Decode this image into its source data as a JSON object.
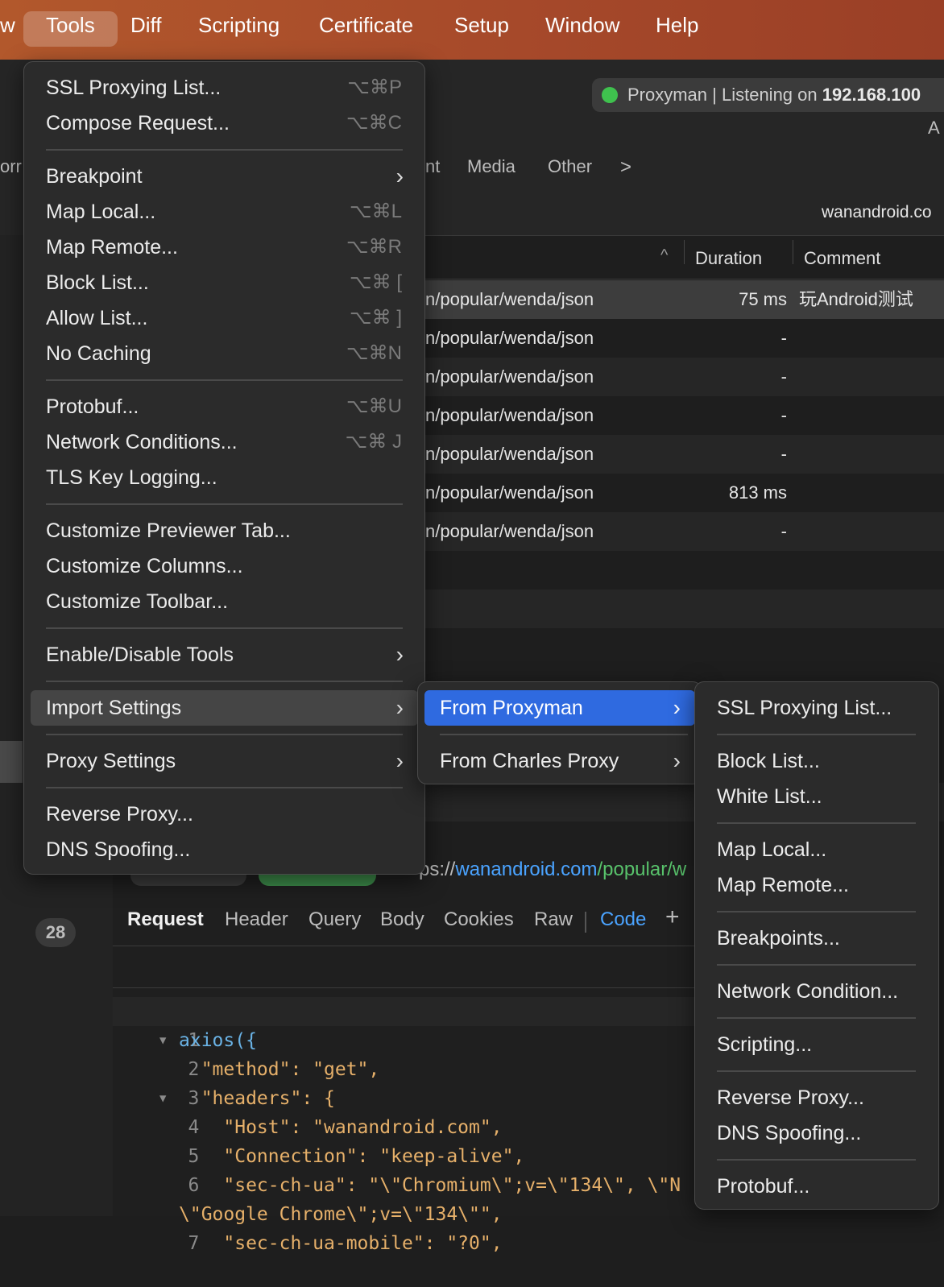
{
  "menubar": {
    "items": [
      "w",
      "Tools",
      "Diff",
      "Scripting",
      "Certificate",
      "Setup",
      "Window",
      "Help"
    ]
  },
  "status": {
    "text_prefix": "Proxyman | Listening on ",
    "ip": "192.168.100",
    "corner_label": "A"
  },
  "filters": {
    "partial": "orr",
    "partial2": "nt",
    "media": "Media",
    "other": "Other",
    "chevron": ">"
  },
  "domain_label": "wanandroid.co",
  "columns": {
    "duration": "Duration",
    "comment": "Comment",
    "sort": "^"
  },
  "rows": [
    {
      "path": "n/popular/wenda/json",
      "duration": "75 ms",
      "comment": "玩Android测试"
    },
    {
      "path": "n/popular/wenda/json",
      "duration": "-",
      "comment": ""
    },
    {
      "path": "n/popular/wenda/json",
      "duration": "-",
      "comment": ""
    },
    {
      "path": "n/popular/wenda/json",
      "duration": "-",
      "comment": ""
    },
    {
      "path": "n/popular/wenda/json",
      "duration": "-",
      "comment": ""
    },
    {
      "path": "n/popular/wenda/json",
      "duration": "813 ms",
      "comment": ""
    },
    {
      "path": "n/popular/wenda/json",
      "duration": "-",
      "comment": ""
    }
  ],
  "badge": "28",
  "url": {
    "prefix": "ps://",
    "host": "wanandroid.com",
    "path": "/popular/w"
  },
  "request_tabs": [
    "Request",
    "Header",
    "Query",
    "Body",
    "Cookies",
    "Raw",
    "Code",
    "+"
  ],
  "code_lines": [
    {
      "n": "1",
      "text": "axios({"
    },
    {
      "n": "2",
      "text": "  \"method\": \"get\","
    },
    {
      "n": "3",
      "text": "  \"headers\": {"
    },
    {
      "n": "4",
      "text": "    \"Host\": \"wanandroid.com\","
    },
    {
      "n": "5",
      "text": "    \"Connection\": \"keep-alive\","
    },
    {
      "n": "6",
      "text": "    \"sec-ch-ua\": \"\\\"Chromium\\\";v=\\\"134\\\", \\\"N"
    },
    {
      "n": "",
      "text": "\\\"Google Chrome\\\";v=\\\"134\\\"\","
    },
    {
      "n": "7",
      "text": "    \"sec-ch-ua-mobile\": \"?0\","
    }
  ],
  "tools_menu": {
    "items": [
      {
        "label": "SSL Proxying List...",
        "shortcut": "⌥⌘P"
      },
      {
        "label": "Compose Request...",
        "shortcut": "⌥⌘C"
      },
      {
        "label": "Breakpoint",
        "submenu": true
      },
      {
        "label": "Map Local...",
        "shortcut": "⌥⌘L"
      },
      {
        "label": "Map Remote...",
        "shortcut": "⌥⌘R"
      },
      {
        "label": "Block List...",
        "shortcut": "⌥⌘ ["
      },
      {
        "label": "Allow List...",
        "shortcut": "⌥⌘ ]"
      },
      {
        "label": "No Caching",
        "shortcut": "⌥⌘N"
      },
      {
        "label": "Protobuf...",
        "shortcut": "⌥⌘U"
      },
      {
        "label": "Network Conditions...",
        "shortcut": "⌥⌘ J"
      },
      {
        "label": "TLS Key Logging..."
      },
      {
        "label": "Customize Previewer Tab..."
      },
      {
        "label": "Customize Columns..."
      },
      {
        "label": "Customize Toolbar..."
      },
      {
        "label": "Enable/Disable Tools",
        "submenu": true
      },
      {
        "label": "Import Settings",
        "submenu": true
      },
      {
        "label": "Proxy Settings",
        "submenu": true
      },
      {
        "label": "Reverse Proxy..."
      },
      {
        "label": "DNS Spoofing..."
      }
    ]
  },
  "import_menu": {
    "items": [
      {
        "label": "From Proxyman",
        "submenu": true
      },
      {
        "label": "From Charles Proxy",
        "submenu": true
      }
    ]
  },
  "proxyman_menu": {
    "items": [
      {
        "label": "SSL Proxying List..."
      },
      {
        "label": "Block List..."
      },
      {
        "label": "White List..."
      },
      {
        "label": "Map Local..."
      },
      {
        "label": "Map Remote..."
      },
      {
        "label": "Breakpoints..."
      },
      {
        "label": "Network Condition..."
      },
      {
        "label": "Scripting..."
      },
      {
        "label": "Reverse Proxy..."
      },
      {
        "label": "DNS Spoofing..."
      },
      {
        "label": "Protobuf..."
      }
    ]
  },
  "colors": {
    "accent": "#2f6ae0",
    "menubar": "#a6492a",
    "status_green": "#3fc14e",
    "link_blue": "#4aa3ff",
    "link_green": "#58c26b"
  }
}
